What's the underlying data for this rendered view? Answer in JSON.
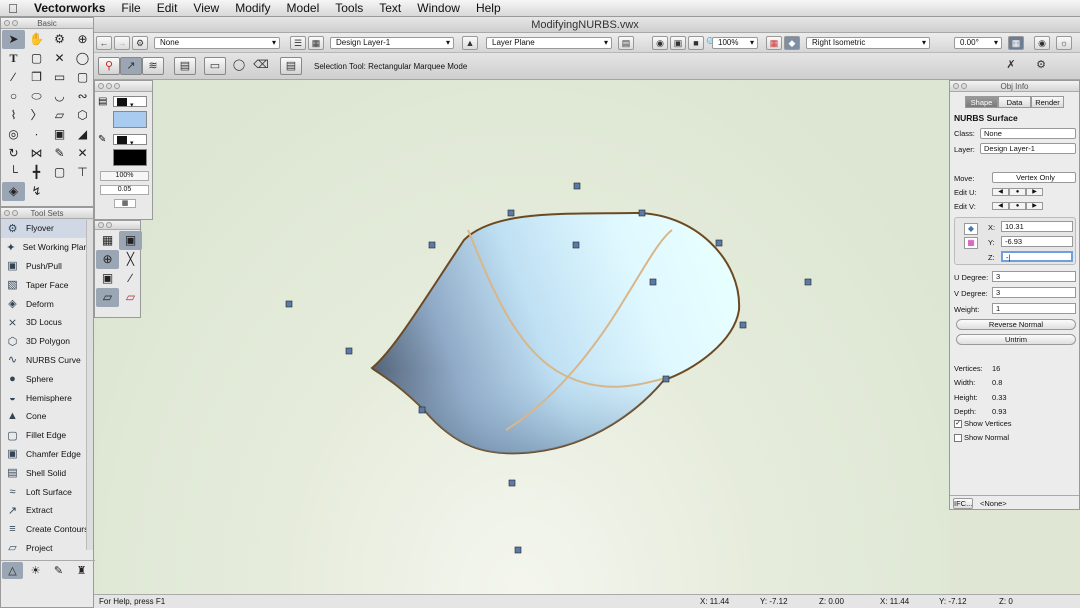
{
  "menubar": {
    "apple": "",
    "items": [
      "Vectorworks",
      "File",
      "Edit",
      "View",
      "Modify",
      "Model",
      "Tools",
      "Text",
      "Window",
      "Help"
    ]
  },
  "window": {
    "title": "ModifyingNURBS.vwx"
  },
  "view_bar": {
    "class_value": "None",
    "layer_value": "Design Layer-1",
    "plane_value": "Layer Plane",
    "zoom_value": "100%",
    "view_value": "Right Isometric",
    "angle_value": "0.00°"
  },
  "mode_bar": {
    "status_text": "Selection Tool: Rectangular Marquee Mode"
  },
  "basic_palette": {
    "title": "Basic"
  },
  "attributes": {
    "opacity": "100%",
    "line_weight": "0.05"
  },
  "tool_sets": {
    "title": "Tool Sets",
    "items": [
      {
        "label": "Flyover",
        "icon": "flyover-icon",
        "glyph": "⚙"
      },
      {
        "label": "Set Working Plane",
        "icon": "working-plane-icon",
        "glyph": "✦"
      },
      {
        "label": "Push/Pull",
        "icon": "push-pull-icon",
        "glyph": "▣"
      },
      {
        "label": "Taper Face",
        "icon": "taper-face-icon",
        "glyph": "▧"
      },
      {
        "label": "Deform",
        "icon": "deform-icon",
        "glyph": "◈"
      },
      {
        "label": "3D Locus",
        "icon": "locus-icon",
        "glyph": "⨯"
      },
      {
        "label": "3D Polygon",
        "icon": "polygon-icon",
        "glyph": "⬡"
      },
      {
        "label": "NURBS Curve",
        "icon": "nurbs-curve-icon",
        "glyph": "∿"
      },
      {
        "label": "Sphere",
        "icon": "sphere-icon",
        "glyph": "●"
      },
      {
        "label": "Hemisphere",
        "icon": "hemisphere-icon",
        "glyph": "◒"
      },
      {
        "label": "Cone",
        "icon": "cone-icon",
        "glyph": "▲"
      },
      {
        "label": "Fillet Edge",
        "icon": "fillet-edge-icon",
        "glyph": "▢"
      },
      {
        "label": "Chamfer Edge",
        "icon": "chamfer-edge-icon",
        "glyph": "▣"
      },
      {
        "label": "Shell Solid",
        "icon": "shell-solid-icon",
        "glyph": "▤"
      },
      {
        "label": "Loft Surface",
        "icon": "loft-surface-icon",
        "glyph": "≈"
      },
      {
        "label": "Extract",
        "icon": "extract-icon",
        "glyph": "↗"
      },
      {
        "label": "Create Contours",
        "icon": "contours-icon",
        "glyph": "≡"
      },
      {
        "label": "Project",
        "icon": "project-icon",
        "glyph": "▱"
      }
    ]
  },
  "obj_info": {
    "title": "Obj Info",
    "tabs": [
      "Shape",
      "Data",
      "Render"
    ],
    "object_type": "NURBS Surface",
    "class_label": "Class:",
    "class_value": "None",
    "layer_label": "Layer:",
    "layer_value": "Design Layer-1",
    "move_label": "Move:",
    "move_value": "Vertex Only",
    "edit_u_label": "Edit U:",
    "edit_v_label": "Edit V:",
    "x_label": "X:",
    "x_value": "10.31",
    "y_label": "Y:",
    "y_value": "-6.93",
    "z_label": "Z:",
    "z_value": "-|",
    "u_degree_label": "U Degree:",
    "u_degree_value": "3",
    "v_degree_label": "V Degree:",
    "v_degree_value": "3",
    "weight_label": "Weight:",
    "weight_value": "1",
    "reverse_normal": "Reverse Normal",
    "untrim": "Untrim",
    "vertices_label": "Vertices:",
    "vertices_value": "16",
    "width_label": "Width:",
    "width_value": "0.8",
    "height_label": "Height:",
    "height_value": "0.33",
    "depth_label": "Depth:",
    "depth_value": "0.93",
    "show_vertices": "Show Vertices",
    "show_normal": "Show Normal",
    "ifc_label": "IFC...",
    "ifc_value": "<None>"
  },
  "statusbar": {
    "help": "For Help, press F1",
    "x": "X: 11.44",
    "y": "Y: -7.12",
    "z": "Z: 0.00",
    "x2": "X: 11.44",
    "y2": "Y: -7.12",
    "z2": "Z: 0"
  },
  "colors": {
    "surface_light": "#e8ffff",
    "surface_mid": "#a9cbe8",
    "surface_dark": "#56677c",
    "edge": "#6b4a22",
    "isoparm": "#d8b68a",
    "handle": "#5a7aa8"
  }
}
